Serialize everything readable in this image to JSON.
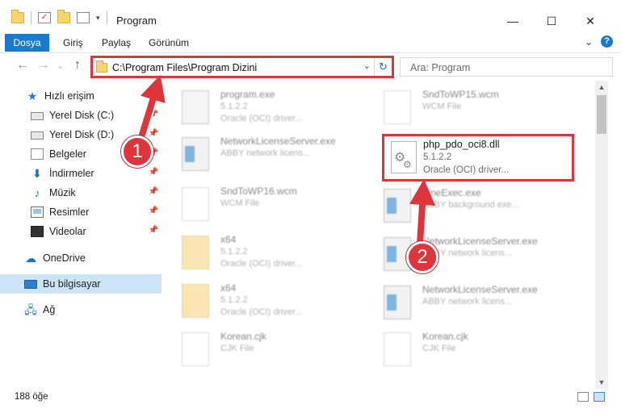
{
  "window": {
    "title": "Program",
    "minimize": "—",
    "maximize": "☐",
    "close": "✕"
  },
  "ribbon": {
    "file_tab": "Dosya",
    "tabs": [
      "Giriş",
      "Paylaş",
      "Görünüm"
    ],
    "collapse": "⌄",
    "help": "?"
  },
  "nav": {
    "back": "←",
    "forward": "→",
    "recent": "⌄",
    "up": "↑",
    "address": "C:\\Program Files\\Program Dizini",
    "address_dropdown": "⌄",
    "refresh": "↻",
    "search_placeholder": "Ara: Program"
  },
  "sidebar": {
    "items": [
      {
        "label": "Hızlı erişim",
        "icon": "star-icon",
        "pinned": false
      },
      {
        "label": "Yerel Disk (C:)",
        "icon": "disk-icon",
        "pinned": true
      },
      {
        "label": "Yerel Disk (D:)",
        "icon": "disk-icon",
        "pinned": true
      },
      {
        "label": "Belgeler",
        "icon": "documents-icon",
        "pinned": true
      },
      {
        "label": "İndirmeler",
        "icon": "download-icon",
        "pinned": true
      },
      {
        "label": "Müzik",
        "icon": "music-icon",
        "pinned": true
      },
      {
        "label": "Resimler",
        "icon": "pictures-icon",
        "pinned": true
      },
      {
        "label": "Videolar",
        "icon": "videos-icon",
        "pinned": true
      },
      {
        "label": "OneDrive",
        "icon": "cloud-icon",
        "pinned": false
      },
      {
        "label": "Bu bilgisayar",
        "icon": "computer-icon",
        "pinned": false,
        "selected": true
      },
      {
        "label": "Ağ",
        "icon": "network-icon",
        "pinned": false
      }
    ],
    "pin_glyph": "📌"
  },
  "files": {
    "left": [
      {
        "name": "program.exe",
        "line2": "5.1.2.2",
        "line3": "Oracle (OCI) driver...",
        "icon": "exe-icon"
      },
      {
        "name": "NetworkLicenseServer.exe",
        "line2": "ABBY network licens...",
        "line3": "",
        "icon": "window-icon"
      },
      {
        "name": "SndToWP16.wcm",
        "line2": "WCM File",
        "line3": "",
        "icon": "page-icon"
      },
      {
        "name": "x64",
        "line2": "5.1.2.2",
        "line3": "Oracle (OCI) driver...",
        "icon": "folder-icon"
      },
      {
        "name": "x64",
        "line2": "5.1.2.2",
        "line3": "Oracle (OCI) driver...",
        "icon": "folder-icon"
      },
      {
        "name": "Korean.cjk",
        "line2": "CJK File",
        "line3": "",
        "icon": "page-icon"
      }
    ],
    "right": [
      {
        "name": "SndToWP15.wcm",
        "line2": "WCM File",
        "line3": "",
        "icon": "page-icon"
      },
      {
        "name": "FineExec.exe",
        "line2": "ABBY background exe...",
        "line3": "",
        "icon": "window-icon"
      },
      {
        "name": "NetworkLicenseServer.exe",
        "line2": "ABBY network licens...",
        "line3": "",
        "icon": "window-icon"
      },
      {
        "name": "NetworkLicenseServer.exe",
        "line2": "ABBY network licens...",
        "line3": "",
        "icon": "window-icon"
      },
      {
        "name": "Korean.cjk",
        "line2": "CJK File",
        "line3": "",
        "icon": "page-icon"
      }
    ],
    "highlighted": {
      "name": "php_pdo_oci8.dll",
      "version": "5.1.2.2",
      "description": "Oracle (OCI) driver..."
    }
  },
  "status": {
    "item_count": "188 öğe"
  },
  "annotations": {
    "badge_1": "1",
    "badge_2": "2",
    "accent": "#e0343b"
  },
  "colors": {
    "brand": "#1979ca",
    "selection": "#cce4f7"
  }
}
